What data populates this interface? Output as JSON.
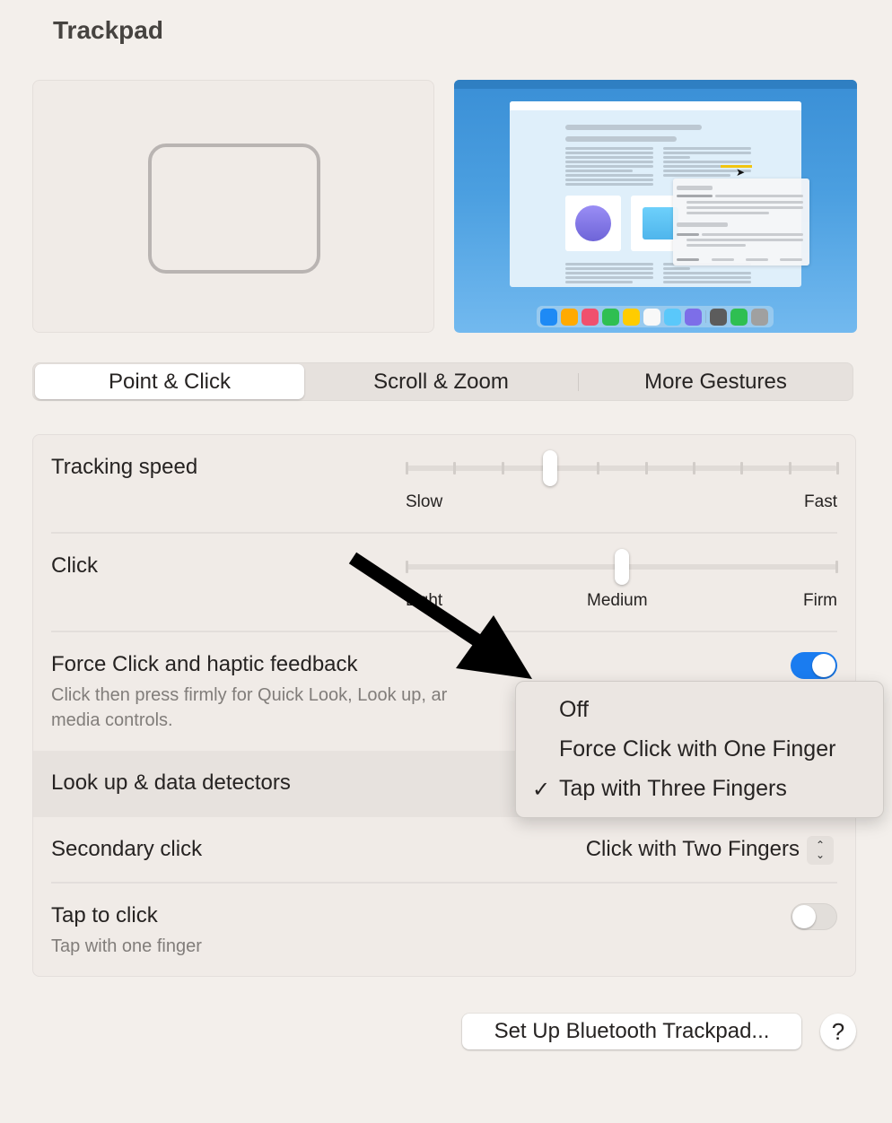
{
  "window": {
    "title": "Trackpad"
  },
  "preview": {
    "dock_colors": [
      "#1e8af5",
      "#ffaa00",
      "#f0506e",
      "#2fbf52",
      "#ffcc00",
      "#f8f8f8",
      "#5ac8fa",
      "#7d6ee8",
      "#5c5c5c",
      "#2fbf52",
      "#a0a0a0"
    ],
    "accent_highlight": "#f1c40f"
  },
  "tabs": [
    {
      "label": "Point & Click",
      "active": true
    },
    {
      "label": "Scroll & Zoom",
      "active": false
    },
    {
      "label": "More Gestures",
      "active": false
    }
  ],
  "settings": {
    "tracking_speed": {
      "label": "Tracking speed",
      "min_label": "Slow",
      "max_label": "Fast",
      "tick_count": 10,
      "value_index": 3
    },
    "click": {
      "label": "Click",
      "options": [
        "Light",
        "Medium",
        "Firm"
      ],
      "value": "Medium"
    },
    "force_click": {
      "label": "Force Click and haptic feedback",
      "description_line1": "Click then press firmly for Quick Look, Look up, ar",
      "description_line2": "media controls.",
      "enabled": true
    },
    "look_up": {
      "label": "Look up & data detectors",
      "menu_options": [
        "Off",
        "Force Click with One Finger",
        "Tap with Three Fingers"
      ],
      "selected": "Tap with Three Fingers",
      "checkmark": "✓"
    },
    "secondary_click": {
      "label": "Secondary click",
      "value": "Click with Two Fingers",
      "stepper_up": "⌃",
      "stepper_down": "⌄"
    },
    "tap_to_click": {
      "label": "Tap to click",
      "description": "Tap with one finger",
      "enabled": false
    }
  },
  "footer": {
    "bluetooth_button": "Set Up Bluetooth Trackpad...",
    "help_button": "?"
  },
  "colors": {
    "accent": "#1a7cf0",
    "background": "#f3efeb",
    "annotation_arrow": "#000000"
  }
}
